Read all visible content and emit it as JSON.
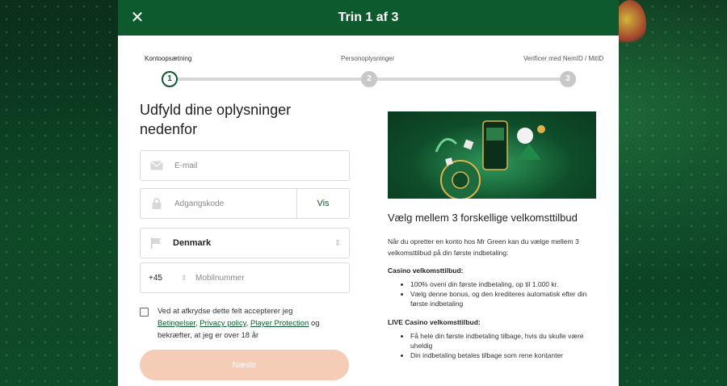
{
  "header": {
    "title": "Trin 1 af 3",
    "close_icon": "close-icon"
  },
  "steps": [
    {
      "label": "Kontoopsætning",
      "number": "1",
      "active": true
    },
    {
      "label": "Personoplysninger",
      "number": "2",
      "active": false
    },
    {
      "label": "Verificer med NemID / MitID",
      "number": "3",
      "active": false
    }
  ],
  "form": {
    "heading_line1": "Udfyld dine oplysninger",
    "heading_line2": "nedenfor",
    "email_placeholder": "E-mail",
    "password_placeholder": "Adgangskode",
    "show_password_label": "Vis",
    "country_value": "Denmark",
    "phone_prefix": "+45",
    "phone_placeholder": "Mobilnummer",
    "terms": {
      "text_before": "Ved at afkrydse dette felt accepterer jeg",
      "link1": "Betingelser",
      "link2": "Privacy policy",
      "link3": "Player Protection",
      "text_og": "og",
      "text_after": "bekræfter, at jeg er over 18 år"
    },
    "next_label": "Næste"
  },
  "promo": {
    "title": "Vælg mellem 3 forskellige velkomsttilbud",
    "intro": "Når du opretter en konto hos Mr Green kan du vælge mellem 3 velkomsttilbud på din første indbetaling:",
    "casino_heading": "Casino velkomsttilbud:",
    "casino_items": [
      "100% oveni din første indbetaling, op til 1.000 kr.",
      "Vælg denne bonus, og den krediteres automatisk efter din første indbetaling"
    ],
    "live_heading": "LIVE Casino velkomsttilbud:",
    "live_items": [
      "Få hele din første indbetaling tilbage, hvis du skulle være uheldig",
      "Din indbetaling betales tilbage som rene kontanter"
    ]
  },
  "colors": {
    "brand_green": "#0d5a2e",
    "button_disabled": "#f5cdb6"
  }
}
